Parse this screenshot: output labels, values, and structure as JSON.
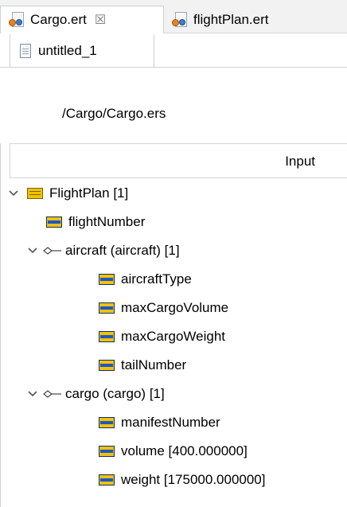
{
  "editor_tabs": [
    {
      "label": "Cargo.ert",
      "icon": "ert-file-icon",
      "active": true,
      "close": "☒"
    },
    {
      "label": "flightPlan.ert",
      "icon": "ert-file-icon",
      "active": false
    }
  ],
  "sub_tabs": [
    {
      "label": "untitled_1",
      "icon": "document-icon"
    }
  ],
  "schema_path": "/Cargo/Cargo.ers",
  "column_header": "Input",
  "tree": {
    "root": {
      "label": "FlightPlan [1]",
      "icon": "element-icon"
    },
    "flight_number": {
      "label": "flightNumber",
      "icon": "field-icon"
    },
    "aircraft": {
      "label": "aircraft (aircraft) [1]",
      "icon": "association-icon"
    },
    "aircraft_type": {
      "label": "aircraftType",
      "icon": "field-icon"
    },
    "max_cargo_volume": {
      "label": "maxCargoVolume",
      "icon": "field-icon"
    },
    "max_cargo_weight": {
      "label": "maxCargoWeight",
      "icon": "field-icon"
    },
    "tail_number": {
      "label": "tailNumber",
      "icon": "field-icon"
    },
    "cargo": {
      "label": "cargo (cargo) [1]",
      "icon": "association-icon"
    },
    "manifest_number": {
      "label": "manifestNumber",
      "icon": "field-icon"
    },
    "volume": {
      "label": "volume [400.000000]",
      "icon": "field-icon"
    },
    "weight": {
      "label": "weight [175000.000000]",
      "icon": "field-icon"
    }
  }
}
